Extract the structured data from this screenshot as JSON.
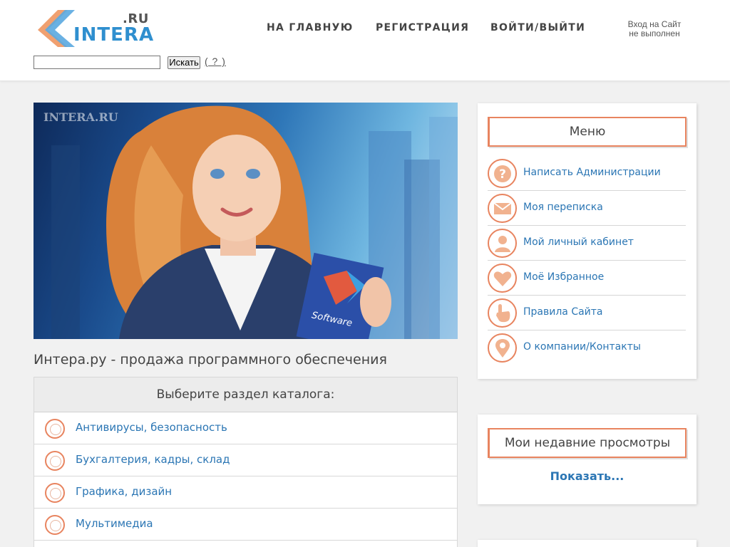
{
  "header": {
    "logo_suffix": ".RU",
    "logo_name": "INTERA",
    "nav": [
      "НА ГЛАВНУЮ",
      "РЕГИСТРАЦИЯ",
      "ВОЙТИ/ВЫЙТИ"
    ],
    "login_status_line1": "Вход на Сайт",
    "login_status_line2": "не выполнен"
  },
  "search": {
    "value": "",
    "button_label": "Искать",
    "help_label": "( ? )"
  },
  "hero": {
    "watermark": "INTERA.RU",
    "book_label": "Software"
  },
  "main": {
    "title": "Интера.ру - продажа программного обеспечения",
    "catalog_heading": "Выберите раздел каталога:",
    "catalog_items": [
      "Антивирусы, безопасность",
      "Бухгалтерия, кадры, склад",
      "Графика, дизайн",
      "Мультимедиа"
    ]
  },
  "sidebar": {
    "menu_title": "Меню",
    "menu_items": [
      {
        "label": "Написать Администрации",
        "icon": "question-icon"
      },
      {
        "label": "Моя переписка",
        "icon": "envelope-icon"
      },
      {
        "label": "Мой личный кабинет",
        "icon": "user-icon"
      },
      {
        "label": "Моё Избранное",
        "icon": "heart-icon"
      },
      {
        "label": "Правила Сайта",
        "icon": "pointer-hand-icon"
      },
      {
        "label": "О компании/Контакты",
        "icon": "map-pin-icon"
      }
    ],
    "recent_title": "Мои недавние просмотры",
    "recent_link": "Показать..."
  },
  "colors": {
    "accent": "#e8845f",
    "link": "#2b76b4",
    "logo_blue": "#2f8fcf"
  }
}
